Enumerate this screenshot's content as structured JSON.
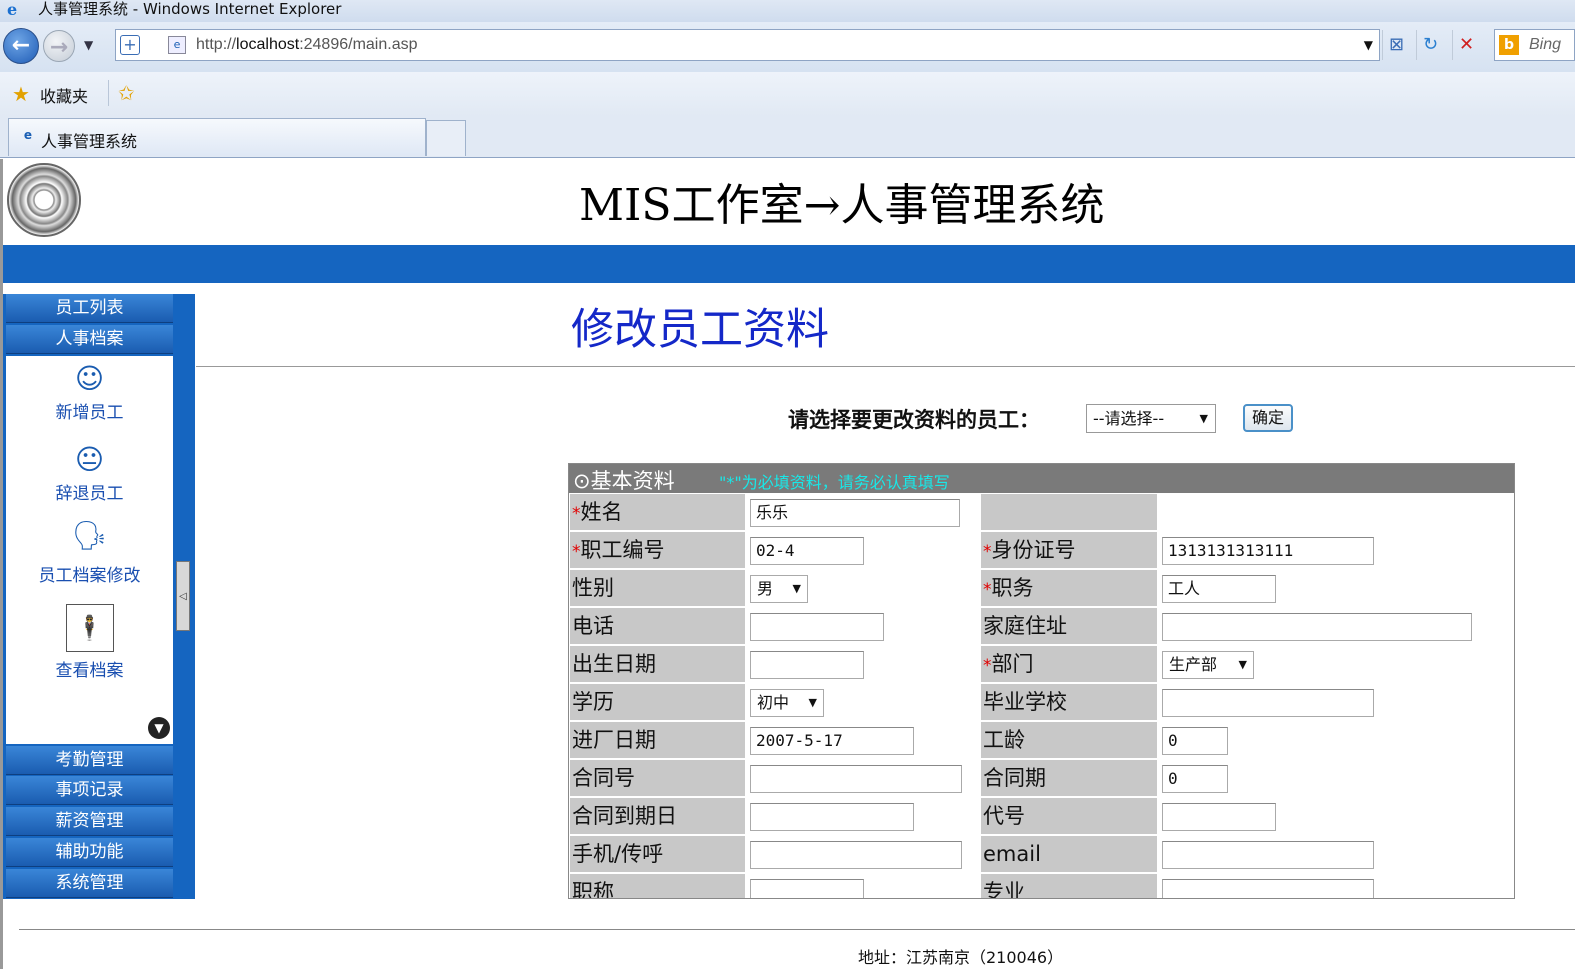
{
  "browser": {
    "window_title": "人事管理系统 - Windows Internet Explorer",
    "url_prefix": "http://",
    "url_host": "localhost",
    "url_rest": ":24896/main.asp",
    "search_provider": "Bing",
    "favorites_label": "收藏夹",
    "tab_title": "人事管理系统"
  },
  "header": {
    "title": "MIS工作室→人事管理系统"
  },
  "sidebar": {
    "top_buttons": [
      "员工列表",
      "人事档案"
    ],
    "panel_items": [
      {
        "label": "新增员工",
        "icon": "smile-face-icon"
      },
      {
        "label": "辞退员工",
        "icon": "neutral-face-icon"
      },
      {
        "label": "员工档案修改",
        "icon": "speaking-head-icon"
      },
      {
        "label": "查看档案",
        "icon": "person-figure-icon"
      }
    ],
    "bottom_buttons": [
      "考勤管理",
      "事项记录",
      "薪资管理",
      "辅助功能",
      "系统管理"
    ]
  },
  "content": {
    "section_title": "修改员工资料",
    "select_prompt": "请选择要更改资料的员工：",
    "select_value": "--请选择--",
    "confirm_button": "确定",
    "form_header": "⊙基本资料",
    "form_note": "\"*\"为必填资料，请务必认真填写",
    "rows": [
      {
        "l1": "姓名",
        "r1": true,
        "v1": "乐乐",
        "l2": "",
        "r2": false,
        "v2": ""
      },
      {
        "l1": "职工编号",
        "r1": true,
        "v1": "02-4",
        "l2": "身份证号",
        "r2": true,
        "v2": "1313131313111"
      },
      {
        "l1": "性别",
        "r1": false,
        "v1": "男",
        "l2": "职务",
        "r2": true,
        "v2": "工人"
      },
      {
        "l1": "电话",
        "r1": false,
        "v1": "",
        "l2": "家庭住址",
        "r2": false,
        "v2": ""
      },
      {
        "l1": "出生日期",
        "r1": false,
        "v1": "",
        "l2": "部门",
        "r2": true,
        "v2": "生产部"
      },
      {
        "l1": "学历",
        "r1": false,
        "v1": "初中",
        "l2": "毕业学校",
        "r2": false,
        "v2": ""
      },
      {
        "l1": "进厂日期",
        "r1": false,
        "v1": "2007-5-17",
        "l2": "工龄",
        "r2": false,
        "v2": "0"
      },
      {
        "l1": "合同号",
        "r1": false,
        "v1": "",
        "l2": "合同期",
        "r2": false,
        "v2": "0"
      },
      {
        "l1": "合同到期日",
        "r1": false,
        "v1": "",
        "l2": "代号",
        "r2": false,
        "v2": ""
      },
      {
        "l1": "手机/传呼",
        "r1": false,
        "v1": "",
        "l2": "email",
        "r2": false,
        "v2": ""
      },
      {
        "l1": "职称",
        "r1": false,
        "v1": "",
        "l2": "专业",
        "r2": false,
        "v2": ""
      }
    ]
  },
  "footer": {
    "address": "地址：江苏南京（210046）"
  }
}
